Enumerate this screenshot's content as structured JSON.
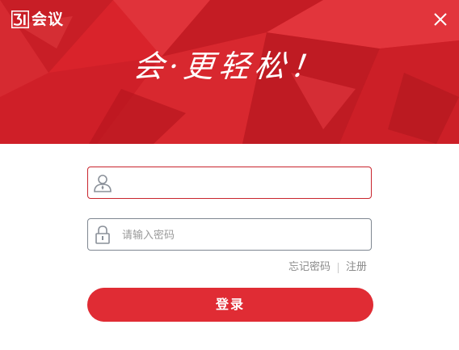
{
  "app": {
    "logo_text": "会议",
    "slogan": "会·更轻松！"
  },
  "login": {
    "username": {
      "value": "",
      "placeholder": ""
    },
    "password": {
      "value": "",
      "placeholder": "请输入密码"
    },
    "forgot_password_label": "忘记密码",
    "register_label": "注册",
    "submit_label": "登录"
  },
  "theme": {
    "banner_color": "#d9232b",
    "button_color": "#e02c34",
    "active_border_color": "#c9252d"
  },
  "icons": {
    "logo": "3i-logo-icon",
    "close": "close-icon",
    "user": "user-icon",
    "lock": "lock-icon"
  }
}
